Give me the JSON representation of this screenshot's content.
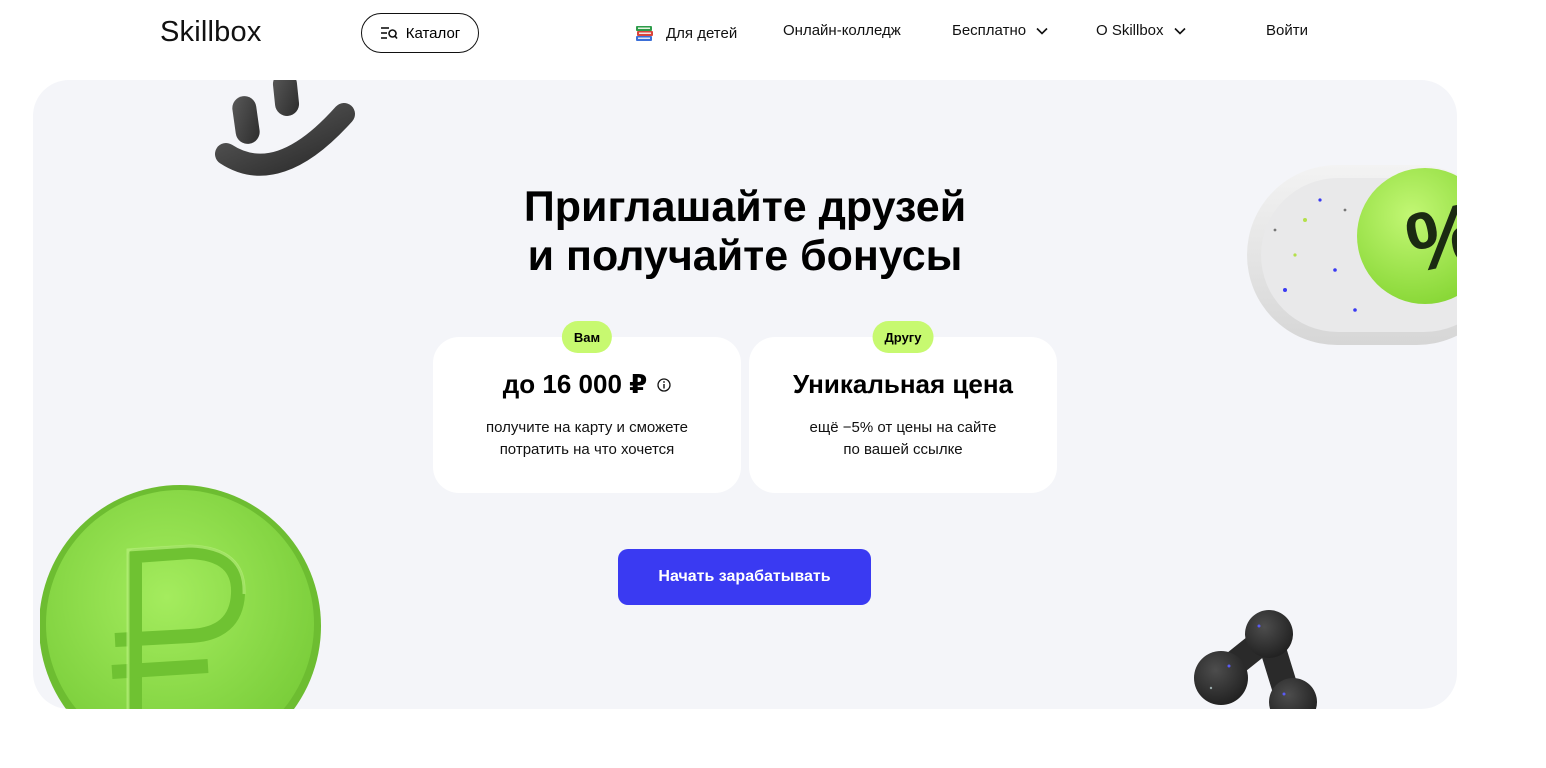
{
  "header": {
    "logo": "Skillbox",
    "catalog_label": "Каталог",
    "nav": {
      "kids": "Для детей",
      "college": "Онлайн-колледж",
      "free": "Бесплатно",
      "about": "О Skillbox",
      "login": "Войти"
    }
  },
  "hero": {
    "title_line1": "Приглашайте друзей",
    "title_line2": "и получайте бонусы",
    "cards": [
      {
        "badge": "Вам",
        "value": "до 16 000 ₽",
        "desc_line1": "получите на карту и сможете",
        "desc_line2": "потратить на что хочется"
      },
      {
        "badge": "Другу",
        "value": "Уникальная цена",
        "desc_line1": "ещё −5% от цены на сайте",
        "desc_line2": "по вашей ссылке"
      }
    ],
    "cta_label": "Начать зарабатывать"
  },
  "decorations": {
    "ruble_coin": "ruble-coin-icon",
    "percent_toggle": "percent-toggle-icon",
    "smiley": "smiley-icon",
    "share": "share-icon",
    "percent_symbol": "%",
    "ruble_symbol": "₽"
  },
  "colors": {
    "accent": "#3a3af2",
    "lime": "#c7f970",
    "hero_bg": "#f4f5f9",
    "coin_green": "#8ee04a",
    "dark": "#3a3a3a"
  }
}
